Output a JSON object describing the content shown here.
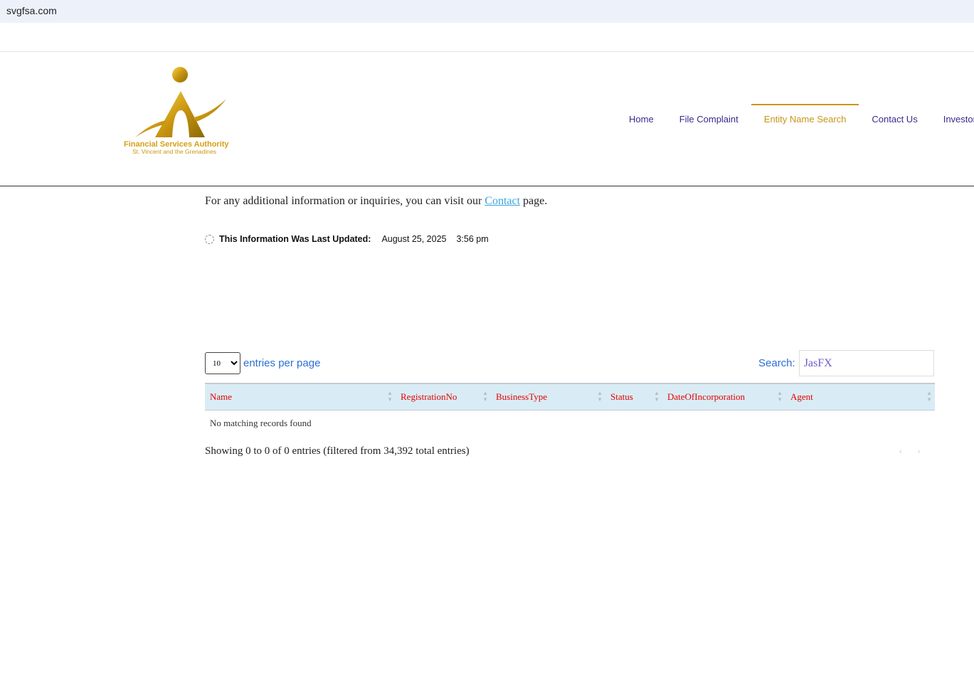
{
  "browser": {
    "url": "svgfsa.com"
  },
  "logo": {
    "line1": "Financial Services Authority",
    "line2": "St. Vincent and the Grenadines",
    "color": "#d4a017"
  },
  "nav": [
    {
      "label": "Home"
    },
    {
      "label": "File Complaint"
    },
    {
      "label": "Entity Name Search",
      "active": true
    },
    {
      "label": "Contact Us"
    },
    {
      "label": "Investor A"
    }
  ],
  "info": {
    "prefix": "For any additional information or inquiries, you can visit our ",
    "link": "Contact",
    "suffix": " page."
  },
  "updated": {
    "label": "This Information Was Last Updated:",
    "date": "August 25, 2025",
    "time": "3:56 pm"
  },
  "table": {
    "length_value": "10",
    "length_label": "entries per page",
    "search_label": "Search:",
    "search_value": "JasFX",
    "columns": [
      "Name",
      "RegistrationNo",
      "BusinessType",
      "Status",
      "DateOfIncorporation",
      "Agent"
    ],
    "empty": "No matching records found",
    "info": "Showing 0 to 0 of 0 entries (filtered from 34,392 total entries)",
    "prev": "‹",
    "next": "›"
  }
}
